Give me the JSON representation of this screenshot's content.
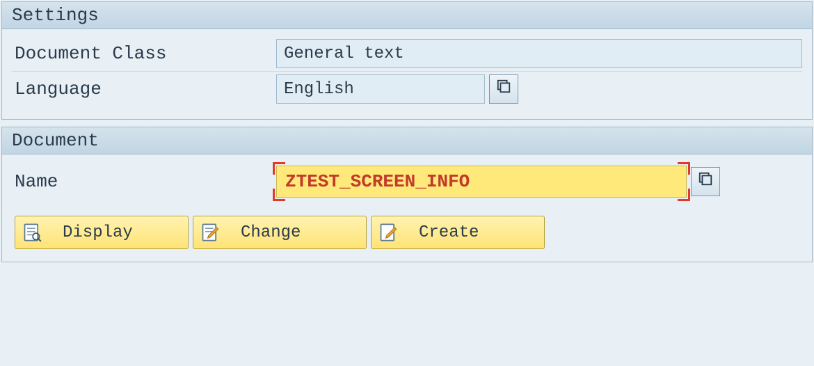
{
  "settings": {
    "title": "Settings",
    "document_class": {
      "label": "Document Class",
      "value": "General text"
    },
    "language": {
      "label": "Language",
      "value": "English"
    }
  },
  "document": {
    "title": "Document",
    "name": {
      "label": "Name",
      "value": "ZTEST_SCREEN_INFO"
    }
  },
  "buttons": {
    "display": "Display",
    "change": "Change",
    "create": "Create"
  }
}
